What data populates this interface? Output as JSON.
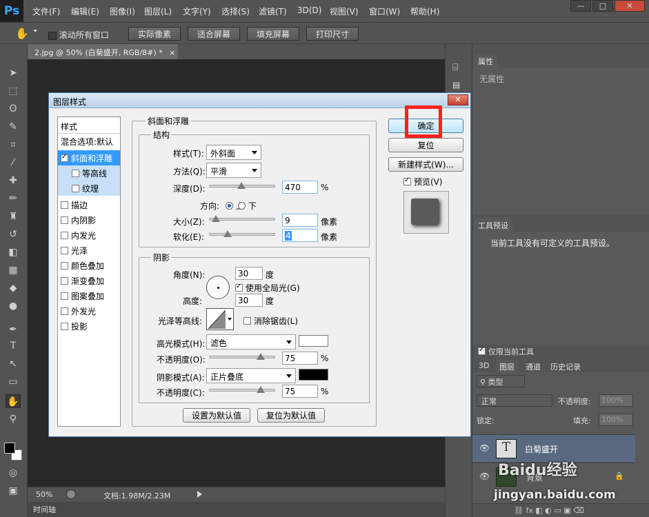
{
  "app": {
    "logo": "Ps"
  },
  "menu": [
    "文件(F)",
    "编辑(E)",
    "图像(I)",
    "图层(L)",
    "文字(Y)",
    "选择(S)",
    "滤镜(T)",
    "3D(D)",
    "视图(V)",
    "窗口(W)",
    "帮助(H)"
  ],
  "window_controls": {
    "minimize": "—",
    "maximize": "□",
    "close": "✕"
  },
  "options": {
    "scroll_all": "滚动所有窗口",
    "buttons": [
      "实际像素",
      "适合屏幕",
      "填充屏幕",
      "打印尺寸"
    ]
  },
  "document": {
    "tab_title": "2.jpg @ 50% (白菊盛开, RGB/8#) *",
    "tab_close": "×"
  },
  "status": {
    "zoom": "50%",
    "doc_info": "文档:1.98M/2.23M"
  },
  "timeline": {
    "label": "时间轴"
  },
  "dialog": {
    "title": "图层样式",
    "close": "✕",
    "style_list": [
      {
        "label": "样式",
        "checkbox": false,
        "checked": false,
        "state": "header"
      },
      {
        "label": "混合选项:默认",
        "checkbox": false,
        "checked": false,
        "state": "normal"
      },
      {
        "label": "斜面和浮雕",
        "checkbox": true,
        "checked": true,
        "state": "selected"
      },
      {
        "label": "等高线",
        "checkbox": true,
        "checked": false,
        "state": "sub"
      },
      {
        "label": "纹理",
        "checkbox": true,
        "checked": false,
        "state": "sub"
      },
      {
        "label": "描边",
        "checkbox": true,
        "checked": false,
        "state": "normal"
      },
      {
        "label": "内阴影",
        "checkbox": true,
        "checked": false,
        "state": "normal"
      },
      {
        "label": "内发光",
        "checkbox": true,
        "checked": false,
        "state": "normal"
      },
      {
        "label": "光泽",
        "checkbox": true,
        "checked": false,
        "state": "normal"
      },
      {
        "label": "颜色叠加",
        "checkbox": true,
        "checked": false,
        "state": "normal"
      },
      {
        "label": "渐变叠加",
        "checkbox": true,
        "checked": false,
        "state": "normal"
      },
      {
        "label": "图案叠加",
        "checkbox": true,
        "checked": false,
        "state": "normal"
      },
      {
        "label": "外发光",
        "checkbox": true,
        "checked": false,
        "state": "normal"
      },
      {
        "label": "投影",
        "checkbox": true,
        "checked": false,
        "state": "normal"
      }
    ],
    "bevel": {
      "group_title": "斜面和浮雕",
      "structure_title": "结构",
      "style_label": "样式(T):",
      "style_value": "外斜面",
      "technique_label": "方法(Q):",
      "technique_value": "平滑",
      "depth_label": "深度(D):",
      "depth_value": "470",
      "depth_unit": "%",
      "direction_label": "方向:",
      "direction_up": "上",
      "direction_down": "下",
      "size_label": "大小(Z):",
      "size_value": "9",
      "size_unit": "像素",
      "soften_label": "软化(E):",
      "soften_value": "4",
      "soften_unit": "像素",
      "shading_title": "阴影",
      "angle_label": "角度(N):",
      "angle_value": "30",
      "angle_unit": "度",
      "global_light": "使用全局光(G)",
      "altitude_label": "高度:",
      "altitude_value": "30",
      "altitude_unit": "度",
      "gloss_label": "光泽等高线:",
      "anti_alias": "消除锯齿(L)",
      "highlight_label": "高光模式(H):",
      "highlight_value": "滤色",
      "highlight_opacity_label": "不透明度(O):",
      "highlight_opacity_value": "75",
      "highlight_opacity_unit": "%",
      "shadow_label": "阴影模式(A):",
      "shadow_value": "正片叠底",
      "shadow_opacity_label": "不透明度(C):",
      "shadow_opacity_value": "75",
      "shadow_opacity_unit": "%",
      "make_default": "设置为默认值",
      "reset_default": "复位为默认值"
    },
    "buttons": {
      "ok": "确定",
      "reset": "复位",
      "new_style": "新建样式(W)...",
      "preview": "预览(V)"
    },
    "colors": {
      "highlight_swatch": "#ffffff",
      "shadow_swatch": "#000000",
      "annotation": "#ff2020"
    }
  },
  "panels": {
    "properties": {
      "tab": "属性",
      "empty": "无属性"
    },
    "tool_presets": {
      "tab": "工具预设",
      "empty": "当前工具没有可定义的工具预设。",
      "current_only": "仅限当前工具"
    },
    "layers": {
      "tabs": [
        "3D",
        "图层",
        "通道",
        "历史记录"
      ],
      "kind_filter": "类型",
      "blend_mode": "正常",
      "opacity_label": "不透明度:",
      "opacity_value": "100%",
      "lock_label": "锁定:",
      "fill_label": "填充:",
      "fill_value": "100%",
      "items": [
        {
          "name": "白菊盛开",
          "thumb": "T"
        },
        {
          "name": "背景",
          "thumb": ""
        }
      ]
    }
  },
  "watermark": {
    "text": "Baidu经验",
    "url": "jingyan.baidu.com"
  }
}
